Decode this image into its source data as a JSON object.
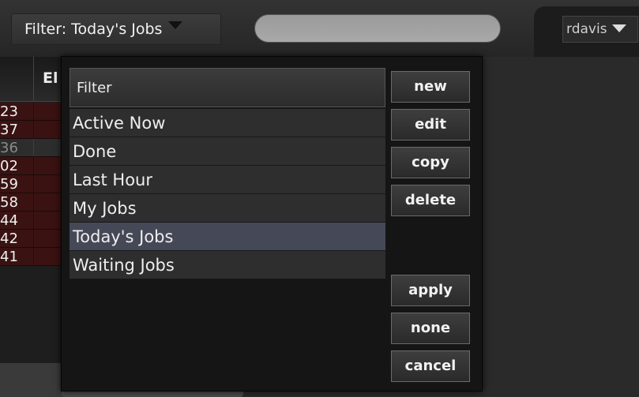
{
  "toolbar": {
    "filter_label": "Filter: Today's Jobs",
    "search_placeholder": "",
    "user": "rdavis"
  },
  "background_table": {
    "header": "El",
    "rows": [
      {
        "value": "23",
        "state": "red"
      },
      {
        "value": "37",
        "state": "red"
      },
      {
        "value": "36",
        "state": "dim"
      },
      {
        "value": "02",
        "state": "red"
      },
      {
        "value": "59",
        "state": "red"
      },
      {
        "value": "58",
        "state": "red"
      },
      {
        "value": "44",
        "state": "red"
      },
      {
        "value": "42",
        "state": "red"
      },
      {
        "value": "41",
        "state": "red"
      }
    ]
  },
  "dialog": {
    "list_header": "Filter",
    "items": [
      {
        "label": "Active Now"
      },
      {
        "label": "Done"
      },
      {
        "label": "Last Hour"
      },
      {
        "label": "My Jobs"
      },
      {
        "label": "Today's Jobs",
        "selected": true
      },
      {
        "label": "Waiting Jobs"
      }
    ],
    "buttons": {
      "new": "new",
      "edit": "edit",
      "copy": "copy",
      "delete": "delete",
      "apply": "apply",
      "none": "none",
      "cancel": "cancel"
    }
  },
  "colors": {
    "selected_row": "#454856",
    "error_row": "#3a1212",
    "dialog_bg": "#151515"
  }
}
